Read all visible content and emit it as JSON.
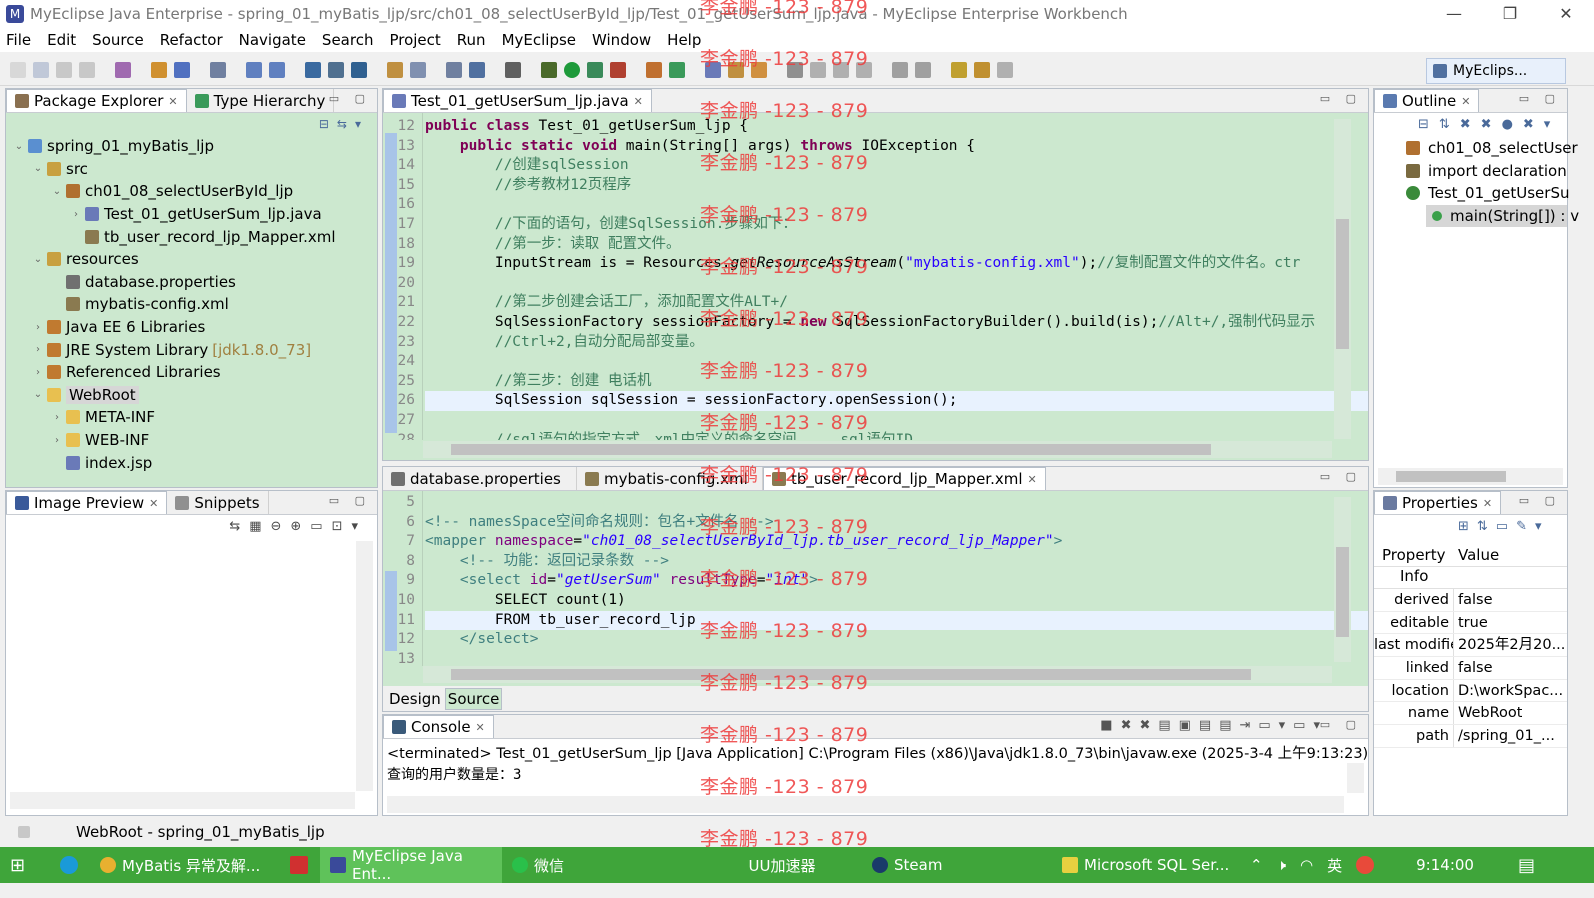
{
  "window": {
    "title": "MyEclipse Java Enterprise - spring_01_myBatis_ljp/src/ch01_08_selectUserById_ljp/Test_01_getUserSum_ljp.java - MyEclipse Enterprise Workbench"
  },
  "menu": [
    "File",
    "Edit",
    "Source",
    "Refactor",
    "Navigate",
    "Search",
    "Project",
    "Run",
    "MyEclipse",
    "Window",
    "Help"
  ],
  "perspective": {
    "label": "MyEclips..."
  },
  "package_explorer": {
    "tabs": [
      "Package Explorer",
      "Type Hierarchy"
    ],
    "tree": [
      {
        "label": "spring_01_myBatis_ljp",
        "indent": 0,
        "arrow": "v",
        "icon": "#5a8fd0"
      },
      {
        "label": "src",
        "indent": 1,
        "arrow": "v",
        "icon": "#c8a040"
      },
      {
        "label": "ch01_08_selectUserById_ljp",
        "indent": 2,
        "arrow": "v",
        "icon": "#b07030"
      },
      {
        "label": "Test_01_getUserSum_ljp.java",
        "indent": 3,
        "arrow": ">",
        "icon": "#6a7ab8"
      },
      {
        "label": "tb_user_record_ljp_Mapper.xml",
        "indent": 3,
        "arrow": "",
        "icon": "#8a7a50"
      },
      {
        "label": "resources",
        "indent": 1,
        "arrow": "v",
        "icon": "#c8a040"
      },
      {
        "label": "database.properties",
        "indent": 2,
        "arrow": "",
        "icon": "#707070"
      },
      {
        "label": "mybatis-config.xml",
        "indent": 2,
        "arrow": "",
        "icon": "#8a7a50"
      },
      {
        "label": "Java EE 6 Libraries",
        "indent": 1,
        "arrow": ">",
        "icon": "#c07a30"
      },
      {
        "label": "JRE System Library",
        "suffix": "[jdk1.8.0_73]",
        "indent": 1,
        "arrow": ">",
        "icon": "#c07a30"
      },
      {
        "label": "Referenced Libraries",
        "indent": 1,
        "arrow": ">",
        "icon": "#c07a30"
      },
      {
        "label": "WebRoot",
        "indent": 1,
        "arrow": "v",
        "icon": "#e8c050",
        "selected": true
      },
      {
        "label": "META-INF",
        "indent": 2,
        "arrow": ">",
        "icon": "#e8c050"
      },
      {
        "label": "WEB-INF",
        "indent": 2,
        "arrow": ">",
        "icon": "#e8c050"
      },
      {
        "label": "index.jsp",
        "indent": 2,
        "arrow": "",
        "icon": "#6a7ab8"
      }
    ]
  },
  "image_preview": {
    "tabs": [
      "Image Preview",
      "Snippets"
    ]
  },
  "editor_java": {
    "tab": "Test_01_getUserSum_ljp.java",
    "lines": [
      {
        "n": "12",
        "html": "<span class=\"kw\">public class</span> Test_01_getUserSum_ljp {"
      },
      {
        "n": "13",
        "html": "    <span class=\"kw\">public static void</span> main(String[] args) <span class=\"kw\">throws</span> IOException {"
      },
      {
        "n": "14",
        "html": "        <span class=\"cm\">//创建sqlSession</span>"
      },
      {
        "n": "15",
        "html": "        <span class=\"cm\">//参考教材12页程序</span>"
      },
      {
        "n": "16",
        "html": ""
      },
      {
        "n": "17",
        "html": "        <span class=\"cm\">//下面的语句，创建SqlSession.步骤如下：</span>"
      },
      {
        "n": "18",
        "html": "        <span class=\"cm\">//第一步：读取 配置文件。</span>"
      },
      {
        "n": "19",
        "html": "        InputStream is = Resources.<i>getResourceAsStream</i>(<span class=\"str\">\"mybatis-config.xml\"</span>);<span class=\"cm\">//复制配置文件的文件名。ctr</span>"
      },
      {
        "n": "20",
        "html": ""
      },
      {
        "n": "21",
        "html": "        <span class=\"cm\">//第二步创建会话工厂，添加配置文件ALT+/</span>"
      },
      {
        "n": "22",
        "html": "        SqlSessionFactory sessionFactory = <span class=\"kw\">new</span> SqlSessionFactoryBuilder().build(is);<span class=\"cm\">//Alt+/,强制代码显示</span>"
      },
      {
        "n": "23",
        "html": "        <span class=\"cm\">//Ctrl+2,自动分配局部变量。</span>"
      },
      {
        "n": "24",
        "html": ""
      },
      {
        "n": "25",
        "html": "        <span class=\"cm\">//第三步：创建 电话机</span>"
      },
      {
        "n": "26",
        "html": "        SqlSession sqlSession = sessionFactory.openSession();",
        "hl": true
      },
      {
        "n": "27",
        "html": ""
      },
      {
        "n": "28",
        "html": "        <span class=\"cm\">//sql语句的指定方式，xml中定义的命名空间.....sql语句ID</span>"
      }
    ]
  },
  "editor_xml": {
    "tabs": [
      "database.properties",
      "mybatis-config.xml",
      "tb_user_record_ljp_Mapper.xml"
    ],
    "lines": [
      {
        "n": "5",
        "html": ""
      },
      {
        "n": "6",
        "html": "<span class=\"tag\">&lt;!-- namesSpace空间命名规则：包名+文件名 --&gt;</span>"
      },
      {
        "n": "7",
        "html": "<span class=\"tag\">&lt;mapper</span> <span class=\"attr\">namespace</span>=<span class=\"aval\">\"ch01_08_selectUserById_ljp.tb_user_record_ljp_Mapper\"</span><span class=\"tag\">&gt;</span>"
      },
      {
        "n": "8",
        "html": "    <span class=\"tag\">&lt;!-- 功能：返回记录条数 --&gt;</span>"
      },
      {
        "n": "9",
        "html": "    <span class=\"tag\">&lt;select</span> <span class=\"attr\">id</span>=<span class=\"aval\">\"getUserSum\"</span> <span class=\"attr\">resultType</span>=<span class=\"aval\">\"int\"</span><span class=\"tag\">&gt;</span>"
      },
      {
        "n": "10",
        "html": "        SELECT count(1)"
      },
      {
        "n": "11",
        "html": "        FROM tb_user_record_ljp",
        "hl": true
      },
      {
        "n": "12",
        "html": "    <span class=\"tag\">&lt;/select&gt;</span>"
      },
      {
        "n": "13",
        "html": ""
      }
    ],
    "bottom_tabs": [
      "Design",
      "Source"
    ]
  },
  "console": {
    "tab": "Console",
    "terminated": "<terminated> Test_01_getUserSum_ljp [Java Application] C:\\Program Files (x86)\\Java\\jdk1.8.0_73\\bin\\javaw.exe (2025-3-4 上午9:13:23)",
    "output": "查询的用户数量是：3"
  },
  "outline": {
    "tab": "Outline",
    "items": [
      "ch01_08_selectUser",
      "import declaration",
      "Test_01_getUserSu",
      "main(String[]) : v"
    ]
  },
  "properties": {
    "tab": "Properties",
    "header_key": "Property",
    "header_value": "Value",
    "info": "Info",
    "rows": [
      {
        "k": "derived",
        "v": "false"
      },
      {
        "k": "editable",
        "v": "true"
      },
      {
        "k": "last modified",
        "v": "2025年2月20..."
      },
      {
        "k": "linked",
        "v": "false"
      },
      {
        "k": "location",
        "v": "D:\\workSpac..."
      },
      {
        "k": "name",
        "v": "WebRoot"
      },
      {
        "k": "path",
        "v": "/spring_01_..."
      }
    ]
  },
  "statusbar": {
    "text": "WebRoot - spring_01_myBatis_ljp"
  },
  "watermark": "李金鹏 -123 - 879",
  "taskbar": {
    "items": [
      "MyBatis 异常及解...",
      "MyEclipse Java Ent...",
      "微信",
      "UU加速器",
      "Steam",
      "Microsoft SQL Ser..."
    ],
    "ime": "英",
    "clock": "9:14:00"
  },
  "colors": {
    "editor_bg": "#cce8cf",
    "keyword": "#7f0055",
    "comment": "#3f7f5f",
    "string": "#2a00ff",
    "watermark": "#ee3b3b",
    "taskbar": "#3fa53a"
  }
}
